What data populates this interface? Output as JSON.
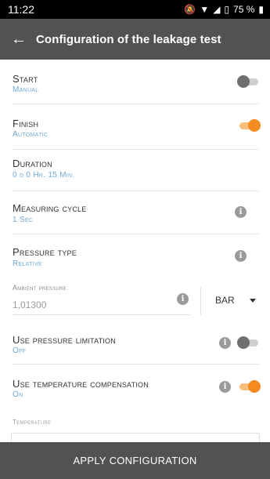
{
  "status_bar": {
    "time": "11:22",
    "battery": "75 %"
  },
  "app_bar": {
    "title": "Configuration of the leakage test"
  },
  "settings": {
    "start": {
      "label": "Start",
      "value": "Manual",
      "toggle": "off"
    },
    "finish": {
      "label": "Finish",
      "value": "Automatic",
      "toggle": "on"
    },
    "duration": {
      "label": "Duration",
      "value": "0 d 0 Hr. 15 Min."
    },
    "measuring_cycle": {
      "label": "Measuring cycle",
      "value": "1 Sec"
    },
    "pressure_type": {
      "label": "Pressure type",
      "value": "Relative"
    },
    "ambient_pressure": {
      "label": "Ambient pressure",
      "value": "1,01300",
      "unit": "BAR"
    },
    "pressure_limitation": {
      "label": "Use pressure limitation",
      "value": "Off",
      "toggle": "off"
    },
    "temperature_compensation": {
      "label": "Use temperature compensation",
      "value": "On",
      "toggle": "on"
    },
    "temperature": {
      "label": "Temperature"
    }
  },
  "footer": {
    "apply_label": "APPLY CONFIGURATION"
  },
  "colors": {
    "accent": "#f58a1f",
    "header": "#525252",
    "value_text": "#6ea9d8"
  }
}
